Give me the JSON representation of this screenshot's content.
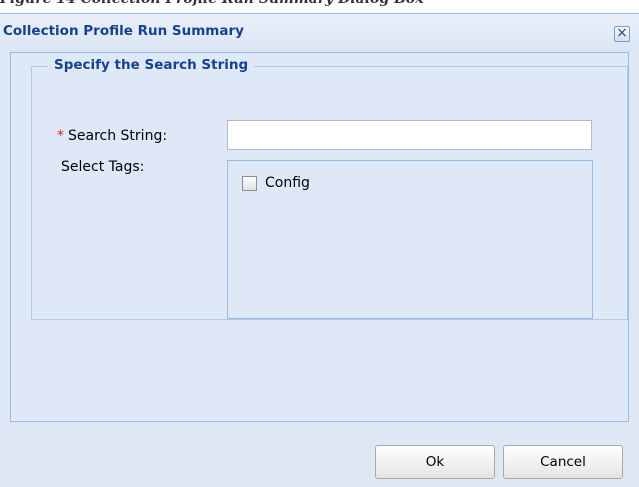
{
  "document": {
    "caption": "Figure 14 Collection Profile Run Summary Dialog Box"
  },
  "dialog": {
    "title": "Collection Profile Run Summary",
    "close_glyph": "×",
    "close_icon": "close-icon"
  },
  "form": {
    "legend": "Specify the Search String",
    "required_marker": "*",
    "search_label": "Search String:",
    "search_value": "",
    "search_placeholder": "",
    "tags_label": "Select Tags:",
    "tags": [
      {
        "label": "Config",
        "checked": false
      }
    ]
  },
  "footer": {
    "ok_label": "Ok",
    "cancel_label": "Cancel"
  },
  "colors": {
    "title_text": "#15428b",
    "panel_bg": "#dfe8f6",
    "border": "#99bbe8",
    "required": "#e02020"
  }
}
